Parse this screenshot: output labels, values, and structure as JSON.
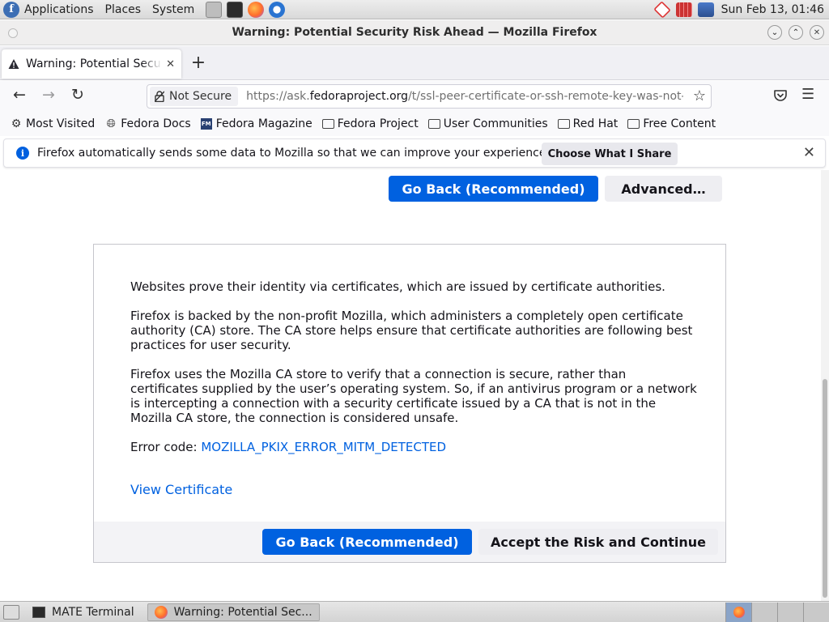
{
  "top_panel": {
    "menus": [
      "Applications",
      "Places",
      "System"
    ],
    "clock": "Sun Feb 13, 01:46"
  },
  "window": {
    "title": "Warning: Potential Security Risk Ahead — Mozilla Firefox"
  },
  "tabs": [
    {
      "label": "Warning: Potential Security Risk Ahead",
      "icon": "warning-icon"
    }
  ],
  "urlbar": {
    "security_label": "Not Secure",
    "url_prefix": "https://ask.",
    "url_host": "fedoraproject.org",
    "url_path": "/t/ssl-peer-certificate-or-ssh-remote-key-was-not-ok"
  },
  "bookmarks": [
    {
      "label": "Most Visited",
      "icon": "gear-icon"
    },
    {
      "label": "Fedora Docs",
      "icon": "globe-icon"
    },
    {
      "label": "Fedora Magazine",
      "icon": "fedora-magazine-icon"
    },
    {
      "label": "Fedora Project",
      "icon": "folder-icon"
    },
    {
      "label": "User Communities",
      "icon": "folder-icon"
    },
    {
      "label": "Red Hat",
      "icon": "folder-icon"
    },
    {
      "label": "Free Content",
      "icon": "folder-icon"
    }
  ],
  "notification": {
    "text": "Firefox automatically sends some data to Mozilla so that we can improve your experience.",
    "button": "Choose What I Share"
  },
  "page": {
    "top_buttons": {
      "go_back": "Go Back (Recommended)",
      "advanced": "Advanced…"
    },
    "panel": {
      "paragraphs": [
        "Websites prove their identity via certificates, which are issued by certificate authorities.",
        "Firefox is backed by the non-profit Mozilla, which administers a completely open certificate authority (CA) store. The CA store helps ensure that certificate authorities are following best practices for user security.",
        "Firefox uses the Mozilla CA store to verify that a connection is secure, rather than certificates supplied by the user’s operating system. So, if an antivirus program or a network is intercepting a connection with a security certificate issued by a CA that is not in the Mozilla CA store, the connection is considered unsafe."
      ],
      "error_label": "Error code: ",
      "error_code": "MOZILLA_PKIX_ERROR_MITM_DETECTED",
      "view_certificate": "View Certificate",
      "footer_go_back": "Go Back (Recommended)",
      "footer_accept": "Accept the Risk and Continue"
    }
  },
  "taskbar": {
    "tasks": [
      {
        "label": "MATE Terminal",
        "active": false
      },
      {
        "label": "Warning: Potential Sec...",
        "active": true
      }
    ]
  },
  "colors": {
    "primary_button": "#0061e0",
    "link": "#0061e0",
    "secondary_button": "#eeeef2"
  }
}
